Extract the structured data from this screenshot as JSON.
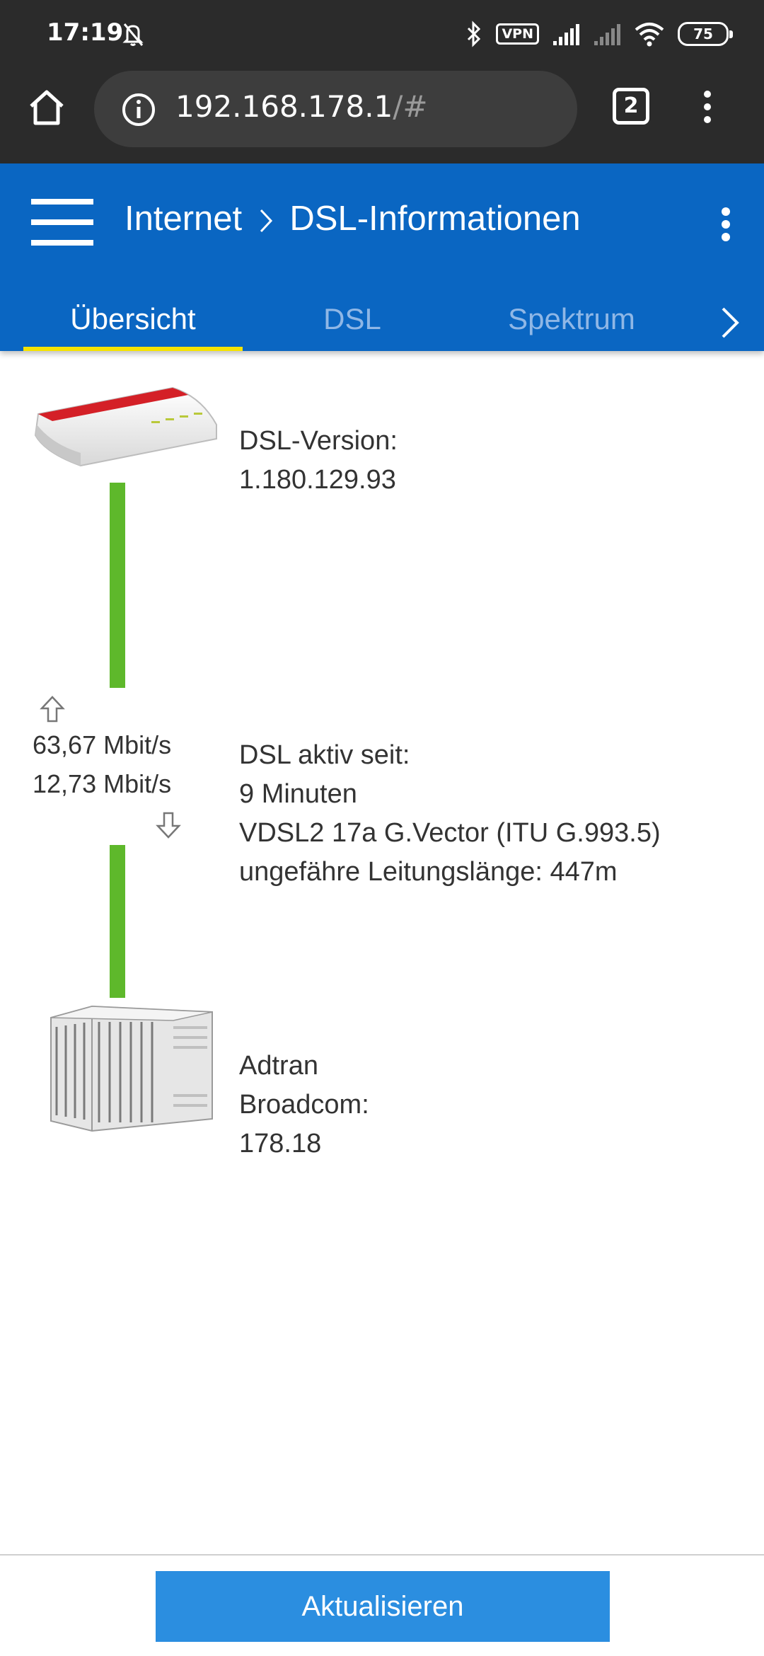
{
  "status_bar": {
    "time": "17:19",
    "vpn_label": "VPN",
    "battery_level": "75",
    "icons": [
      "bell-off-icon",
      "bluetooth-icon",
      "vpn-icon",
      "signal-icon",
      "signal-icon",
      "wifi-icon",
      "battery-icon"
    ]
  },
  "browser": {
    "url_host": "192.168.178.1",
    "url_rest": "/#",
    "tab_count": "2"
  },
  "header": {
    "breadcrumb_parent": "Internet",
    "breadcrumb_current": "DSL-Informationen",
    "tabs": [
      {
        "label": "Übersicht",
        "active": true
      },
      {
        "label": "DSL",
        "active": false
      },
      {
        "label": "Spektrum",
        "active": false
      }
    ],
    "accent_color": "#0a66c2",
    "active_tab_indicator_color": "#f5e300"
  },
  "overview": {
    "router_info": {
      "label": "DSL-Version:",
      "value": "1.180.129.93"
    },
    "line": {
      "upstream": "63,67 Mbit/s",
      "downstream": "12,73 Mbit/s",
      "status_color": "#5eb82b",
      "active_label": "DSL aktiv seit:",
      "active_duration": "9 Minuten",
      "mode": "VDSL2 17a G.Vector (ITU G.993.5)",
      "length": "ungefähre Leitungslänge: 447m"
    },
    "dslam_info": {
      "vendor": "Adtran",
      "chipset_label": "Broadcom:",
      "chipset_version": "178.18"
    }
  },
  "footer": {
    "refresh_label": "Aktualisieren"
  }
}
